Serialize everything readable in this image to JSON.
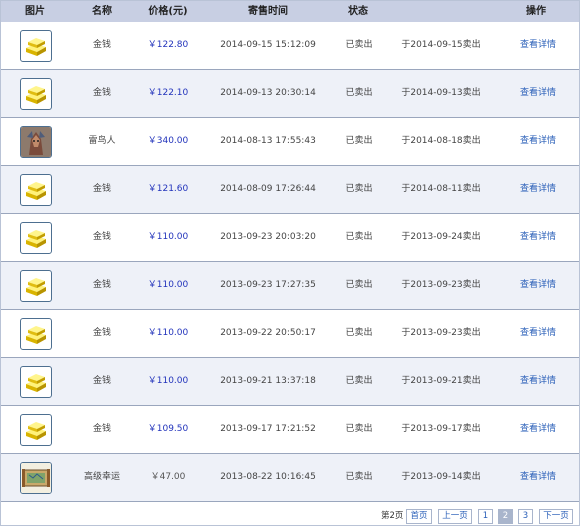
{
  "columns": [
    "图片",
    "名称",
    "价格(元)",
    "寄售时间",
    "状态",
    "操作"
  ],
  "rows": [
    {
      "icon": "gold-bars-icon",
      "name": "金钱",
      "price": "￥122.80",
      "time": "2014-09-15 15:12:09",
      "status": "已卖出",
      "sold": "于2014-09-15卖出",
      "action": "查看详情"
    },
    {
      "icon": "gold-bars-icon",
      "name": "金钱",
      "price": "￥122.10",
      "time": "2014-09-13 20:30:14",
      "status": "已卖出",
      "sold": "于2014-09-13卖出",
      "action": "查看详情"
    },
    {
      "icon": "thunderbird-portrait-icon",
      "name": "雷鸟人",
      "price": "￥340.00",
      "time": "2014-08-13 17:55:43",
      "status": "已卖出",
      "sold": "于2014-08-18卖出",
      "action": "查看详情"
    },
    {
      "icon": "gold-bars-icon",
      "name": "金钱",
      "price": "￥121.60",
      "time": "2014-08-09 17:26:44",
      "status": "已卖出",
      "sold": "于2014-08-11卖出",
      "action": "查看详情"
    },
    {
      "icon": "gold-bars-icon",
      "name": "金钱",
      "price": "￥110.00",
      "time": "2013-09-23 20:03:20",
      "status": "已卖出",
      "sold": "于2013-09-24卖出",
      "action": "查看详情"
    },
    {
      "icon": "gold-bars-icon",
      "name": "金钱",
      "price": "￥110.00",
      "time": "2013-09-23 17:27:35",
      "status": "已卖出",
      "sold": "于2013-09-23卖出",
      "action": "查看详情"
    },
    {
      "icon": "gold-bars-icon",
      "name": "金钱",
      "price": "￥110.00",
      "time": "2013-09-22 20:50:17",
      "status": "已卖出",
      "sold": "于2013-09-23卖出",
      "action": "查看详情"
    },
    {
      "icon": "gold-bars-icon",
      "name": "金钱",
      "price": "￥110.00",
      "time": "2013-09-21 13:37:18",
      "status": "已卖出",
      "sold": "于2013-09-21卖出",
      "action": "查看详情"
    },
    {
      "icon": "gold-bars-icon",
      "name": "金钱",
      "price": "￥109.50",
      "time": "2013-09-17 17:21:52",
      "status": "已卖出",
      "sold": "于2013-09-17卖出",
      "action": "查看详情"
    },
    {
      "icon": "map-scroll-icon",
      "name": "高级幸运",
      "price": "￥47.00",
      "time": "2013-08-22 10:16:45",
      "status": "已卖出",
      "sold": "于2013-09-14卖出",
      "action": "查看详情"
    }
  ],
  "pager": {
    "info": "第2页",
    "first": "首页",
    "prev": "上一页",
    "pages": [
      "1",
      "2",
      "3"
    ],
    "current": "2",
    "next": "下一页"
  },
  "colors": {
    "header_bg": "#c8cfe3",
    "price": "#2233bb",
    "link": "#2a5fb8",
    "alt_row": "#eef1f8"
  }
}
